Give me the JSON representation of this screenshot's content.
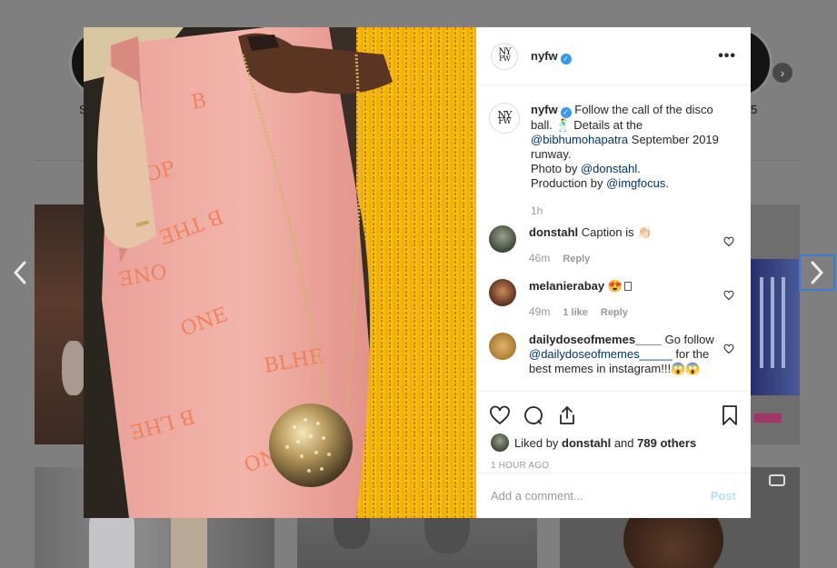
{
  "background": {
    "story_labels": [
      "S",
      "5"
    ]
  },
  "post": {
    "username": "nyfw",
    "logo_text": [
      "NY",
      "FW"
    ],
    "caption": {
      "username": "nyfw",
      "part1": "Follow the call of the disco ball. ",
      "emoji": "🕺",
      "part2": " Details at the ",
      "mention1": "@bibhumohapatra",
      "part3": " September 2019 runway.",
      "photo_by": "Photo by ",
      "mention2": "@donstahl",
      "period": ".",
      "production_by": "Production by ",
      "mention3": "@imgfocus",
      "time": "1h"
    },
    "comments": [
      {
        "username": "donstahl",
        "text": "Caption is ",
        "emoji": "👏🏻",
        "time": "46m",
        "likes": "",
        "reply": "Reply"
      },
      {
        "username": "melanierabay",
        "text": "",
        "emoji": "😍",
        "time": "49m",
        "likes": "1 like",
        "reply": "Reply"
      },
      {
        "username": "dailydoseofmemes____",
        "text": " Go follow ",
        "mention": "@dailydoseofmemes_____",
        "text2": " for the best memes in instagram!!!",
        "emoji": "😱😱"
      }
    ],
    "liked_by": {
      "prefix": "Liked by ",
      "user": "donstahl",
      "middle": " and ",
      "count": "789 others"
    },
    "timestamp": "1 HOUR AGO",
    "add_comment": {
      "placeholder": "Add a comment...",
      "post_label": "Post"
    }
  },
  "colors": {
    "accent": "#3897f0",
    "link": "#003569",
    "post_disabled": "#b2dffc",
    "overlay": "#7f7f7f"
  },
  "icons": [
    "heart-icon",
    "comment-icon",
    "share-icon",
    "bookmark-icon",
    "chevron-left-icon",
    "chevron-right-icon",
    "more-icon",
    "verified-icon",
    "video-icon"
  ]
}
